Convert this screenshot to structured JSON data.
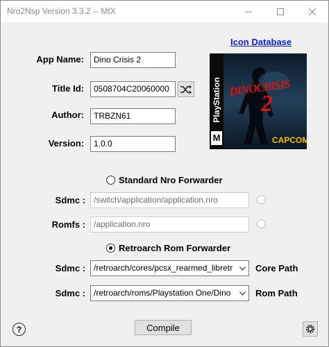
{
  "window": {
    "title": "Nro2Nsp Version 3.3.2 -- MtX"
  },
  "form": {
    "app_name_label": "App Name:",
    "app_name_value": "Dino Crisis 2",
    "title_id_label": "Title Id:",
    "title_id_value": "0508704C20060000",
    "author_label": "Author:",
    "author_value": "TRBZN61",
    "version_label": "Version:",
    "version_value": "1.0.0"
  },
  "icon_database_link": "Icon Database",
  "cover_art": {
    "platform_text": "PlayStation",
    "title_text": "DINOCRISIS",
    "number_text": "2",
    "rating_text": "M",
    "publisher_text": "CAPCOM"
  },
  "standard": {
    "radio_label": "Standard Nro Forwarder",
    "selected": false,
    "sdmc_label": "Sdmc :",
    "sdmc_value": "/switch/application/application.nro",
    "romfs_label": "Romfs :",
    "romfs_value": "/application.nro"
  },
  "retroarch": {
    "radio_label": "Retroarch Rom Forwarder",
    "selected": true,
    "core_sdmc_label": "Sdmc :",
    "core_value": "/retroarch/cores/pcsx_rearmed_libretro",
    "core_side_label": "Core Path",
    "rom_sdmc_label": "Sdmc :",
    "rom_value": "/retroarch/roms/Playstation One/Dino",
    "rom_side_label": "Rom Path"
  },
  "compile_label": "Compile",
  "colors": {
    "link": "#0a1fd6",
    "window_bg": "#f0f0f0",
    "publisher": "#f2c200"
  }
}
